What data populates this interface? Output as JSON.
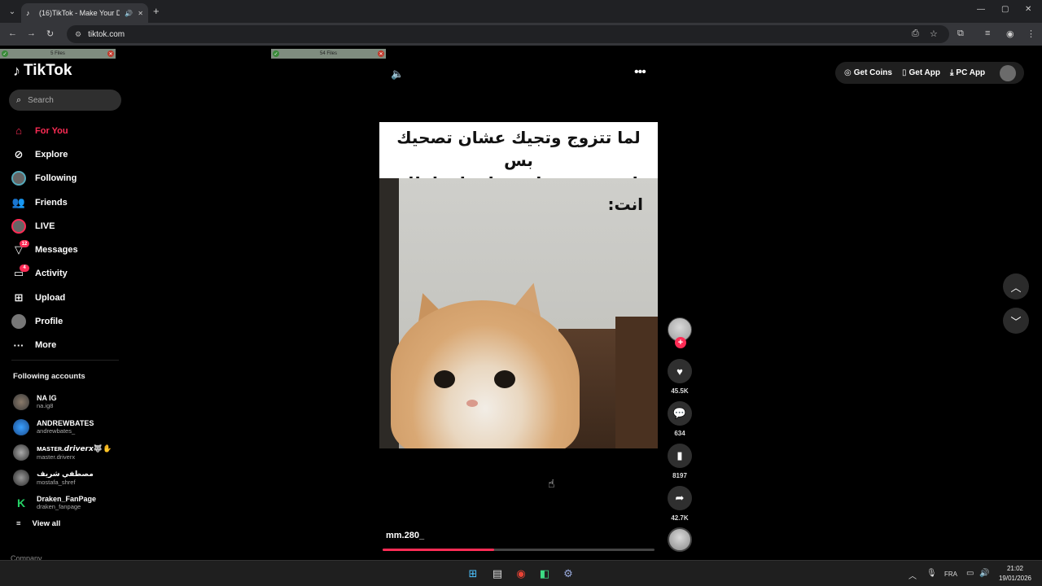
{
  "browser": {
    "tab_title": "(16)TikTok - Make Your Day",
    "url": "tiktok.com"
  },
  "extensions": {
    "bar1_label": "5 Files",
    "bar2_label": "54 Files"
  },
  "sidebar": {
    "logo": "TikTok",
    "search_placeholder": "Search",
    "nav": [
      {
        "label": "For You"
      },
      {
        "label": "Explore"
      },
      {
        "label": "Following"
      },
      {
        "label": "Friends"
      },
      {
        "label": "LIVE"
      },
      {
        "label": "Messages",
        "badge": "12"
      },
      {
        "label": "Activity",
        "badge": "4"
      },
      {
        "label": "Upload"
      },
      {
        "label": "Profile"
      },
      {
        "label": "More"
      }
    ],
    "following_title": "Following accounts",
    "following": [
      {
        "name": "NA IG",
        "handle": "na.ig8"
      },
      {
        "name": "ANDREWBATES",
        "handle": "andrewbates_"
      },
      {
        "name": "ᴍᴀsᴛᴇʀ.𝙙𝙧𝙞𝙫𝙚𝙧𝙭🐺✋",
        "handle": "master.driverx"
      },
      {
        "name": "مصطفي شريف",
        "handle": "mostafa_shref"
      },
      {
        "name": "Draken_FanPage",
        "handle": "draken_fanpage"
      }
    ],
    "view_all": "View all",
    "company": "Company"
  },
  "video": {
    "caption_line1": "لما تتزوج وتجيك عشان تصحيك بس",
    "caption_line2": "انت متعود على مداهمات اهلك",
    "overlay": "انت:",
    "author": "mm.280_",
    "progress_fraction": 0.41
  },
  "actions": {
    "likes": "45.5K",
    "comments": "634",
    "saves": "8197",
    "shares": "42.7K"
  },
  "header": {
    "get_coins": "Get Coins",
    "get_app": "Get App",
    "pc_app": "PC App"
  },
  "taskbar": {
    "lang": "FRA",
    "time": "21:02",
    "date": "19/01/2026"
  },
  "colors": {
    "accent": "#fe2c55"
  }
}
